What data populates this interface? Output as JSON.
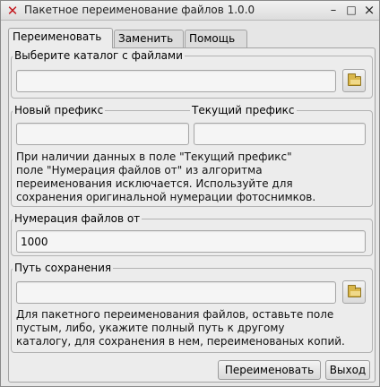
{
  "window": {
    "title": "Пакетное переименование файлов 1.0.0",
    "app_icon": "x-icon",
    "controls": {
      "minimize": "–",
      "maximize": "□",
      "close": "×"
    }
  },
  "tabs": [
    {
      "label": "Переименовать",
      "active": true
    },
    {
      "label": "Заменить",
      "active": false
    },
    {
      "label": "Помощь",
      "active": false
    }
  ],
  "directory": {
    "label": "Выберите каталог с файлами",
    "value": "",
    "browse_icon": "folder-icon"
  },
  "prefix": {
    "new_label": "Новый префикс",
    "new_value": "",
    "current_label": "Текущий префикс",
    "current_value": "",
    "note_lines": [
      "При наличии данных в поле \"Текущий префикс\"",
      "поле \"Нумерация файлов от\" из алгоритма",
      "переименования исключается. Используйте для",
      "сохранения оригинальной нумерации фотоснимков."
    ]
  },
  "numbering": {
    "label": "Нумерация файлов от",
    "value": "1000"
  },
  "save_path": {
    "label": "Путь сохранения",
    "value": "",
    "browse_icon": "folder-icon",
    "note_lines": [
      "Для пакетного переименования файлов, оставьте поле",
      "пустым, либо, укажите полный путь к другому",
      "каталогу, для сохранения в нем, переименованых копий."
    ]
  },
  "buttons": {
    "rename": "Переименовать",
    "exit": "Выход"
  }
}
